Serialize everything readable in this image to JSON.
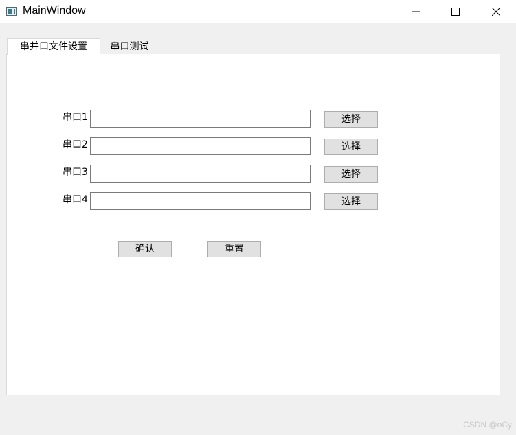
{
  "window": {
    "title": "MainWindow"
  },
  "tabs": [
    {
      "label": "串并口文件设置",
      "active": true
    },
    {
      "label": "串口测试",
      "active": false
    }
  ],
  "ports": [
    {
      "label": "串口1",
      "value": "",
      "button": "选择"
    },
    {
      "label": "串口2",
      "value": "",
      "button": "选择"
    },
    {
      "label": "串口3",
      "value": "",
      "button": "选择"
    },
    {
      "label": "串口4",
      "value": "",
      "button": "选择"
    }
  ],
  "actions": {
    "confirm": "确认",
    "reset": "重置"
  },
  "watermark": "CSDN @oCy",
  "icons": {
    "app": "window-app-icon",
    "minimize": "minimize-icon",
    "maximize": "maximize-icon",
    "close": "close-icon"
  }
}
